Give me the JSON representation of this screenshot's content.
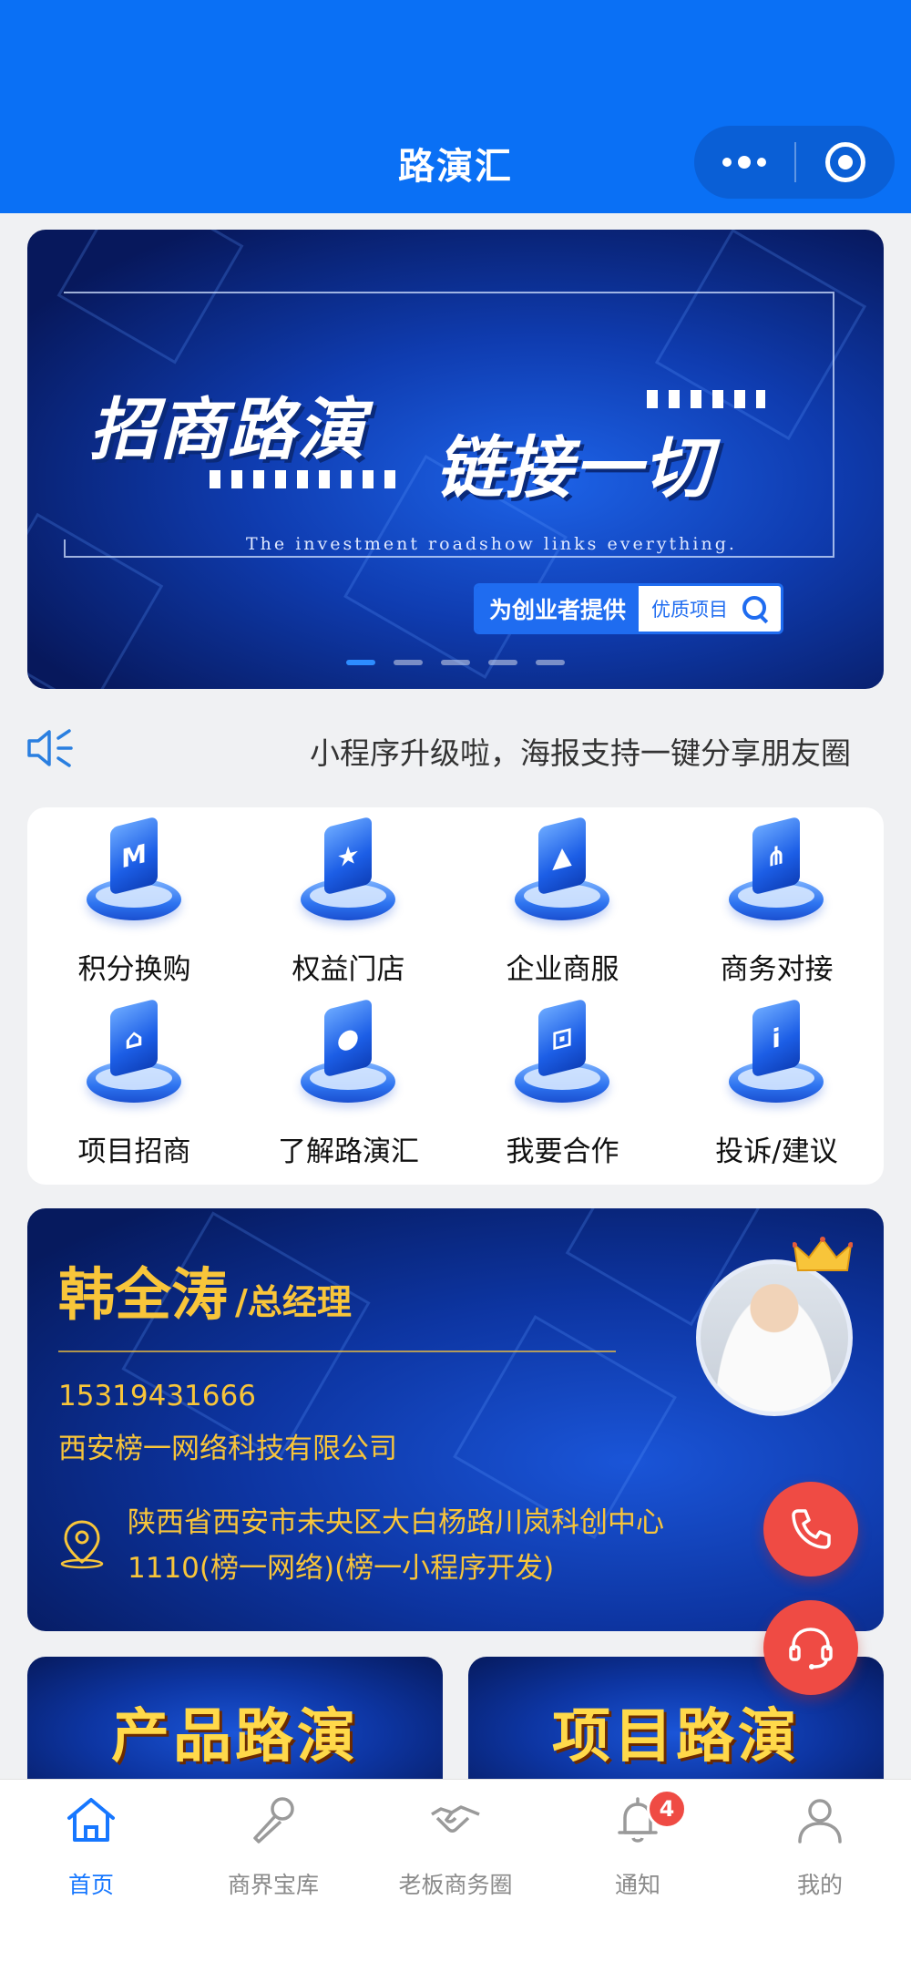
{
  "header": {
    "title": "路演汇"
  },
  "banner": {
    "headline_left": "招商路演",
    "headline_right": "链接一切",
    "subtitle": "The investment roadshow links everything.",
    "box_left": "为创业者提供",
    "box_right": "优质项目",
    "slide_count": 5,
    "active_slide": 1
  },
  "notice": {
    "text": "小程序升级啦，海报支持一键分享朋友圈"
  },
  "menu": {
    "items": [
      {
        "label": "积分换购",
        "icon": "points-exchange-icon",
        "glyph": "M"
      },
      {
        "label": "权益门店",
        "icon": "benefit-store-icon",
        "glyph": "★"
      },
      {
        "label": "企业商服",
        "icon": "enterprise-service-icon",
        "glyph": "▲"
      },
      {
        "label": "商务对接",
        "icon": "business-connect-icon",
        "glyph": "⋔"
      },
      {
        "label": "项目招商",
        "icon": "project-investment-icon",
        "glyph": "⌂"
      },
      {
        "label": "了解路演汇",
        "icon": "about-icon",
        "glyph": "●"
      },
      {
        "label": "我要合作",
        "icon": "cooperate-icon",
        "glyph": "⊡"
      },
      {
        "label": "投诉/建议",
        "icon": "complaint-icon",
        "glyph": "i"
      }
    ]
  },
  "card": {
    "name": "韩全涛",
    "title": "/总经理",
    "phone": "15319431666",
    "company": "西安榜一网络科技有限公司",
    "address": "陕西省西安市未央区大白杨路川岚科创中心1110(榜一网络)(榜一小程序开发)"
  },
  "promos": [
    {
      "label": "产品路演"
    },
    {
      "label": "项目路演"
    }
  ],
  "tabbar": {
    "items": [
      {
        "label": "首页",
        "active": true
      },
      {
        "label": "商界宝库",
        "active": false
      },
      {
        "label": "老板商务圈",
        "active": false
      },
      {
        "label": "通知",
        "active": false,
        "badge": "4"
      },
      {
        "label": "我的",
        "active": false
      }
    ]
  },
  "colors": {
    "primary": "#0a70f5",
    "accent_gold": "#f8c53a",
    "fab_red": "#ef4b44",
    "tab_active": "#1677ff"
  }
}
